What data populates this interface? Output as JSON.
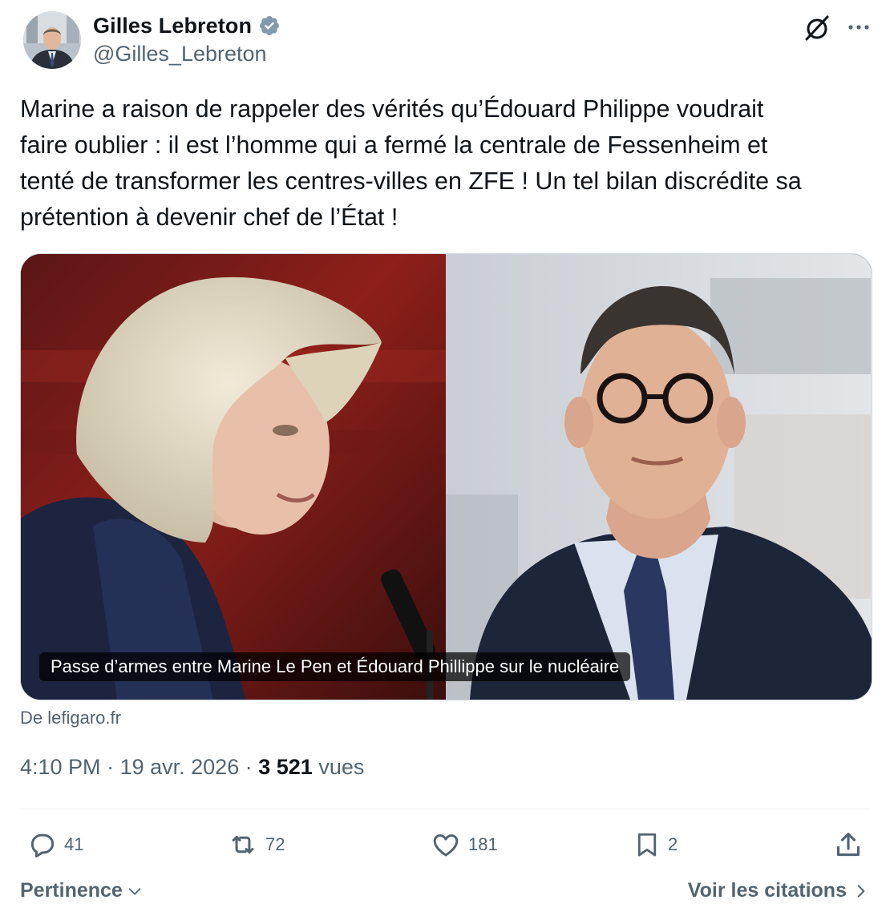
{
  "author": {
    "display_name": "Gilles Lebreton",
    "handle": "@Gilles_Lebreton",
    "verified": true,
    "verified_color": "#829aab"
  },
  "header_icons": [
    "grok-icon",
    "more-icon"
  ],
  "tweet": {
    "text": "Marine a raison de rappeler des vérités qu’Édouard Philippe voudrait\nfaire oublier : il est l’homme qui a fermé la centrale de Fessenheim et\ntenté de transformer les centres-villes en ZFE ! Un tel bilan discrédite sa\nprétention à devenir chef de l’État !"
  },
  "card": {
    "caption": "Passe d’armes entre Marine Le Pen et Édouard Phillippe sur le nucléaire",
    "source": "De lefigaro.fr"
  },
  "meta": {
    "time": "4:10 PM",
    "separator": "·",
    "date": "19 avr. 2026",
    "views_count": "3 521",
    "views_label": "vues"
  },
  "actions": {
    "replies": "41",
    "reposts": "72",
    "likes": "181",
    "bookmarks": "2"
  },
  "footer": {
    "sort_label": "Pertinence",
    "quotes_label": "Voir les citations"
  },
  "colors": {
    "text": "#0f1419",
    "secondary": "#536471",
    "border": "#cfd9de"
  }
}
